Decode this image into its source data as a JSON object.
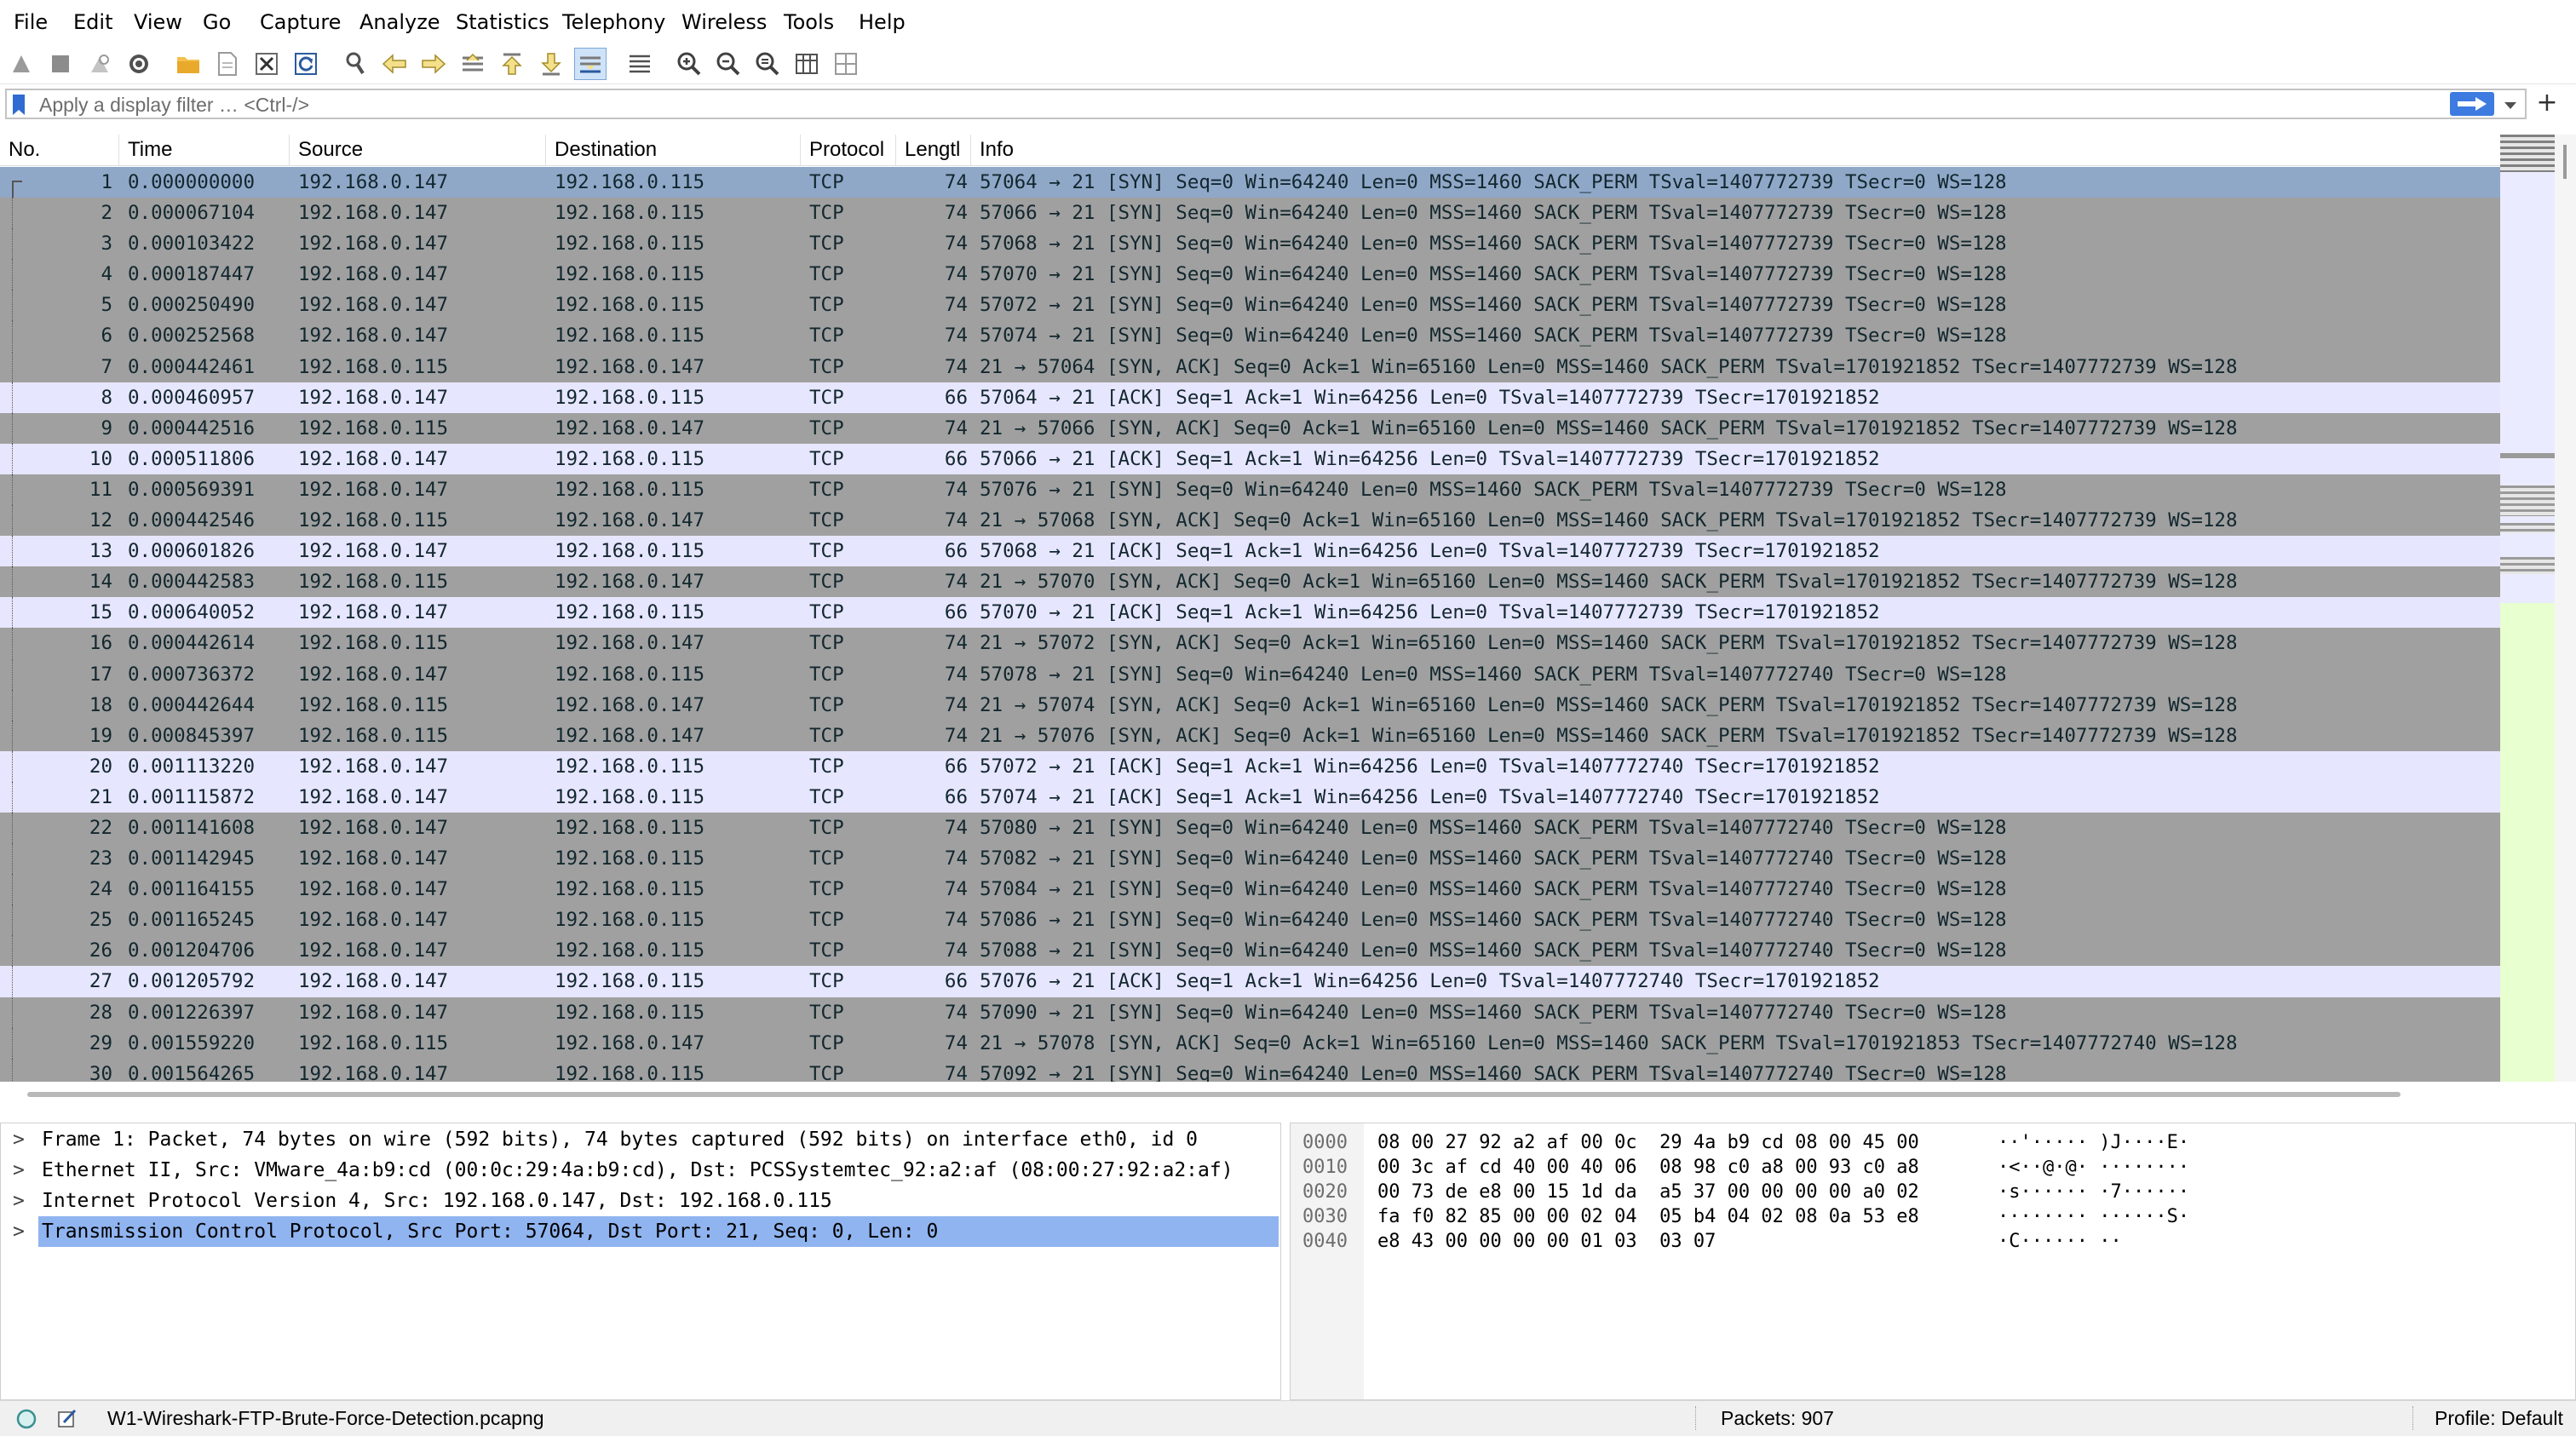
{
  "menu": [
    "File",
    "Edit",
    "View",
    "Go",
    "Capture",
    "Analyze",
    "Statistics",
    "Telephony",
    "Wireless",
    "Tools",
    "Help"
  ],
  "toolbar_icons": [
    "shark-fin-start-icon",
    "stop-square-icon",
    "shark-fin-restart-icon",
    "gear-options-icon",
    "folder-open-icon",
    "document-save-icon",
    "close-file-icon",
    "reload-icon",
    "find-magnifier-icon",
    "arrow-left-icon",
    "arrow-right-icon",
    "go-to-packet-icon",
    "go-first-icon",
    "go-last-icon",
    "autoscroll-icon",
    "colorize-icon",
    "zoom-in-icon",
    "zoom-out-icon",
    "zoom-normal-icon",
    "resize-columns-icon",
    "layout-icon"
  ],
  "filter": {
    "placeholder": "Apply a display filter … <Ctrl-/>",
    "value": "",
    "plus_label": "+"
  },
  "columns": [
    "No.",
    "Time",
    "Source",
    "Destination",
    "Protocol",
    "Lengtl",
    "Info"
  ],
  "packets": [
    {
      "no": "1",
      "time": "0.000000000",
      "src": "192.168.0.147",
      "dst": "192.168.0.115",
      "proto": "TCP",
      "len": "74",
      "info": "57064 → 21 [SYN] Seq=0 Win=64240 Len=0 MSS=1460 SACK_PERM TSval=1407772739 TSecr=0 WS=128",
      "kind": "selected"
    },
    {
      "no": "2",
      "time": "0.000067104",
      "src": "192.168.0.147",
      "dst": "192.168.0.115",
      "proto": "TCP",
      "len": "74",
      "info": "57066 → 21 [SYN] Seq=0 Win=64240 Len=0 MSS=1460 SACK_PERM TSval=1407772739 TSecr=0 WS=128",
      "kind": "syn"
    },
    {
      "no": "3",
      "time": "0.000103422",
      "src": "192.168.0.147",
      "dst": "192.168.0.115",
      "proto": "TCP",
      "len": "74",
      "info": "57068 → 21 [SYN] Seq=0 Win=64240 Len=0 MSS=1460 SACK_PERM TSval=1407772739 TSecr=0 WS=128",
      "kind": "syn"
    },
    {
      "no": "4",
      "time": "0.000187447",
      "src": "192.168.0.147",
      "dst": "192.168.0.115",
      "proto": "TCP",
      "len": "74",
      "info": "57070 → 21 [SYN] Seq=0 Win=64240 Len=0 MSS=1460 SACK_PERM TSval=1407772739 TSecr=0 WS=128",
      "kind": "syn"
    },
    {
      "no": "5",
      "time": "0.000250490",
      "src": "192.168.0.147",
      "dst": "192.168.0.115",
      "proto": "TCP",
      "len": "74",
      "info": "57072 → 21 [SYN] Seq=0 Win=64240 Len=0 MSS=1460 SACK_PERM TSval=1407772739 TSecr=0 WS=128",
      "kind": "syn"
    },
    {
      "no": "6",
      "time": "0.000252568",
      "src": "192.168.0.147",
      "dst": "192.168.0.115",
      "proto": "TCP",
      "len": "74",
      "info": "57074 → 21 [SYN] Seq=0 Win=64240 Len=0 MSS=1460 SACK_PERM TSval=1407772739 TSecr=0 WS=128",
      "kind": "syn"
    },
    {
      "no": "7",
      "time": "0.000442461",
      "src": "192.168.0.115",
      "dst": "192.168.0.147",
      "proto": "TCP",
      "len": "74",
      "info": "21 → 57064 [SYN, ACK] Seq=0 Ack=1 Win=65160 Len=0 MSS=1460 SACK_PERM TSval=1701921852 TSecr=1407772739 WS=128",
      "kind": "syn"
    },
    {
      "no": "8",
      "time": "0.000460957",
      "src": "192.168.0.147",
      "dst": "192.168.0.115",
      "proto": "TCP",
      "len": "66",
      "info": "57064 → 21 [ACK] Seq=1 Ack=1 Win=64256 Len=0 TSval=1407772739 TSecr=1701921852",
      "kind": "ack"
    },
    {
      "no": "9",
      "time": "0.000442516",
      "src": "192.168.0.115",
      "dst": "192.168.0.147",
      "proto": "TCP",
      "len": "74",
      "info": "21 → 57066 [SYN, ACK] Seq=0 Ack=1 Win=65160 Len=0 MSS=1460 SACK_PERM TSval=1701921852 TSecr=1407772739 WS=128",
      "kind": "syn"
    },
    {
      "no": "10",
      "time": "0.000511806",
      "src": "192.168.0.147",
      "dst": "192.168.0.115",
      "proto": "TCP",
      "len": "66",
      "info": "57066 → 21 [ACK] Seq=1 Ack=1 Win=64256 Len=0 TSval=1407772739 TSecr=1701921852",
      "kind": "ack"
    },
    {
      "no": "11",
      "time": "0.000569391",
      "src": "192.168.0.147",
      "dst": "192.168.0.115",
      "proto": "TCP",
      "len": "74",
      "info": "57076 → 21 [SYN] Seq=0 Win=64240 Len=0 MSS=1460 SACK_PERM TSval=1407772739 TSecr=0 WS=128",
      "kind": "syn"
    },
    {
      "no": "12",
      "time": "0.000442546",
      "src": "192.168.0.115",
      "dst": "192.168.0.147",
      "proto": "TCP",
      "len": "74",
      "info": "21 → 57068 [SYN, ACK] Seq=0 Ack=1 Win=65160 Len=0 MSS=1460 SACK_PERM TSval=1701921852 TSecr=1407772739 WS=128",
      "kind": "syn"
    },
    {
      "no": "13",
      "time": "0.000601826",
      "src": "192.168.0.147",
      "dst": "192.168.0.115",
      "proto": "TCP",
      "len": "66",
      "info": "57068 → 21 [ACK] Seq=1 Ack=1 Win=64256 Len=0 TSval=1407772739 TSecr=1701921852",
      "kind": "ack"
    },
    {
      "no": "14",
      "time": "0.000442583",
      "src": "192.168.0.115",
      "dst": "192.168.0.147",
      "proto": "TCP",
      "len": "74",
      "info": "21 → 57070 [SYN, ACK] Seq=0 Ack=1 Win=65160 Len=0 MSS=1460 SACK_PERM TSval=1701921852 TSecr=1407772739 WS=128",
      "kind": "syn"
    },
    {
      "no": "15",
      "time": "0.000640052",
      "src": "192.168.0.147",
      "dst": "192.168.0.115",
      "proto": "TCP",
      "len": "66",
      "info": "57070 → 21 [ACK] Seq=1 Ack=1 Win=64256 Len=0 TSval=1407772739 TSecr=1701921852",
      "kind": "ack"
    },
    {
      "no": "16",
      "time": "0.000442614",
      "src": "192.168.0.115",
      "dst": "192.168.0.147",
      "proto": "TCP",
      "len": "74",
      "info": "21 → 57072 [SYN, ACK] Seq=0 Ack=1 Win=65160 Len=0 MSS=1460 SACK_PERM TSval=1701921852 TSecr=1407772739 WS=128",
      "kind": "syn"
    },
    {
      "no": "17",
      "time": "0.000736372",
      "src": "192.168.0.147",
      "dst": "192.168.0.115",
      "proto": "TCP",
      "len": "74",
      "info": "57078 → 21 [SYN] Seq=0 Win=64240 Len=0 MSS=1460 SACK_PERM TSval=1407772740 TSecr=0 WS=128",
      "kind": "syn"
    },
    {
      "no": "18",
      "time": "0.000442644",
      "src": "192.168.0.115",
      "dst": "192.168.0.147",
      "proto": "TCP",
      "len": "74",
      "info": "21 → 57074 [SYN, ACK] Seq=0 Ack=1 Win=65160 Len=0 MSS=1460 SACK_PERM TSval=1701921852 TSecr=1407772739 WS=128",
      "kind": "syn"
    },
    {
      "no": "19",
      "time": "0.000845397",
      "src": "192.168.0.115",
      "dst": "192.168.0.147",
      "proto": "TCP",
      "len": "74",
      "info": "21 → 57076 [SYN, ACK] Seq=0 Ack=1 Win=65160 Len=0 MSS=1460 SACK_PERM TSval=1701921852 TSecr=1407772739 WS=128",
      "kind": "syn"
    },
    {
      "no": "20",
      "time": "0.001113220",
      "src": "192.168.0.147",
      "dst": "192.168.0.115",
      "proto": "TCP",
      "len": "66",
      "info": "57072 → 21 [ACK] Seq=1 Ack=1 Win=64256 Len=0 TSval=1407772740 TSecr=1701921852",
      "kind": "ack"
    },
    {
      "no": "21",
      "time": "0.001115872",
      "src": "192.168.0.147",
      "dst": "192.168.0.115",
      "proto": "TCP",
      "len": "66",
      "info": "57074 → 21 [ACK] Seq=1 Ack=1 Win=64256 Len=0 TSval=1407772740 TSecr=1701921852",
      "kind": "ack"
    },
    {
      "no": "22",
      "time": "0.001141608",
      "src": "192.168.0.147",
      "dst": "192.168.0.115",
      "proto": "TCP",
      "len": "74",
      "info": "57080 → 21 [SYN] Seq=0 Win=64240 Len=0 MSS=1460 SACK_PERM TSval=1407772740 TSecr=0 WS=128",
      "kind": "syn"
    },
    {
      "no": "23",
      "time": "0.001142945",
      "src": "192.168.0.147",
      "dst": "192.168.0.115",
      "proto": "TCP",
      "len": "74",
      "info": "57082 → 21 [SYN] Seq=0 Win=64240 Len=0 MSS=1460 SACK_PERM TSval=1407772740 TSecr=0 WS=128",
      "kind": "syn"
    },
    {
      "no": "24",
      "time": "0.001164155",
      "src": "192.168.0.147",
      "dst": "192.168.0.115",
      "proto": "TCP",
      "len": "74",
      "info": "57084 → 21 [SYN] Seq=0 Win=64240 Len=0 MSS=1460 SACK_PERM TSval=1407772740 TSecr=0 WS=128",
      "kind": "syn"
    },
    {
      "no": "25",
      "time": "0.001165245",
      "src": "192.168.0.147",
      "dst": "192.168.0.115",
      "proto": "TCP",
      "len": "74",
      "info": "57086 → 21 [SYN] Seq=0 Win=64240 Len=0 MSS=1460 SACK_PERM TSval=1407772740 TSecr=0 WS=128",
      "kind": "syn"
    },
    {
      "no": "26",
      "time": "0.001204706",
      "src": "192.168.0.147",
      "dst": "192.168.0.115",
      "proto": "TCP",
      "len": "74",
      "info": "57088 → 21 [SYN] Seq=0 Win=64240 Len=0 MSS=1460 SACK_PERM TSval=1407772740 TSecr=0 WS=128",
      "kind": "syn"
    },
    {
      "no": "27",
      "time": "0.001205792",
      "src": "192.168.0.147",
      "dst": "192.168.0.115",
      "proto": "TCP",
      "len": "66",
      "info": "57076 → 21 [ACK] Seq=1 Ack=1 Win=64256 Len=0 TSval=1407772740 TSecr=1701921852",
      "kind": "ack"
    },
    {
      "no": "28",
      "time": "0.001226397",
      "src": "192.168.0.147",
      "dst": "192.168.0.115",
      "proto": "TCP",
      "len": "74",
      "info": "57090 → 21 [SYN] Seq=0 Win=64240 Len=0 MSS=1460 SACK_PERM TSval=1407772740 TSecr=0 WS=128",
      "kind": "syn"
    },
    {
      "no": "29",
      "time": "0.001559220",
      "src": "192.168.0.115",
      "dst": "192.168.0.147",
      "proto": "TCP",
      "len": "74",
      "info": "21 → 57078 [SYN, ACK] Seq=0 Ack=1 Win=65160 Len=0 MSS=1460 SACK_PERM TSval=1701921853 TSecr=1407772740 WS=128",
      "kind": "syn"
    },
    {
      "no": "30",
      "time": "0.001564265",
      "src": "192.168.0.147",
      "dst": "192.168.0.115",
      "proto": "TCP",
      "len": "74",
      "info": "57092 → 21 [SYN] Seq=0 Win=64240 Len=0 MSS=1460 SACK_PERM TSval=1407772740 TSecr=0 WS=128",
      "kind": "syn"
    }
  ],
  "row_colors": {
    "syn": "#a0a0a0",
    "ack": "#e7e6ff",
    "selected": "#90a8c8",
    "text": "#12272e"
  },
  "details": [
    {
      "text": "Frame 1: Packet, 74 bytes on wire (592 bits), 74 bytes captured (592 bits) on interface eth0, id 0",
      "selected": false
    },
    {
      "text": "Ethernet II, Src: VMware_4a:b9:cd (00:0c:29:4a:b9:cd), Dst: PCSSystemtec_92:a2:af (08:00:27:92:a2:af)",
      "selected": false
    },
    {
      "text": "Internet Protocol Version 4, Src: 192.168.0.147, Dst: 192.168.0.115",
      "selected": false
    },
    {
      "text": "Transmission Control Protocol, Src Port: 57064, Dst Port: 21, Seq: 0, Len: 0",
      "selected": true
    }
  ],
  "bytes": [
    {
      "offset": "0000",
      "hex": "08 00 27 92 a2 af 00 0c  29 4a b9 cd 08 00 45 00",
      "ascii": "··'····· )J····E·"
    },
    {
      "offset": "0010",
      "hex": "00 3c af cd 40 00 40 06  08 98 c0 a8 00 93 c0 a8",
      "ascii": "·<··@·@· ········"
    },
    {
      "offset": "0020",
      "hex": "00 73 de e8 00 15 1d da  a5 37 00 00 00 00 a0 02",
      "ascii": "·s······ ·7······"
    },
    {
      "offset": "0030",
      "hex": "fa f0 82 85 00 00 02 04  05 b4 04 02 08 0a 53 e8",
      "ascii": "········ ······S·"
    },
    {
      "offset": "0040",
      "hex": "e8 43 00 00 00 00 01 03  03 07",
      "ascii": "·C······ ··"
    }
  ],
  "status": {
    "file": "W1-Wireshark-FTP-Brute-Force-Detection.pcapng",
    "packets": "Packets: 907",
    "profile": "Profile: Default"
  },
  "colors": {
    "selected_detail": "#90b4f0",
    "minimap_green": "#e8ffd0",
    "minimap_lavender": "#ebebff",
    "accent": "#4a7fd8"
  }
}
